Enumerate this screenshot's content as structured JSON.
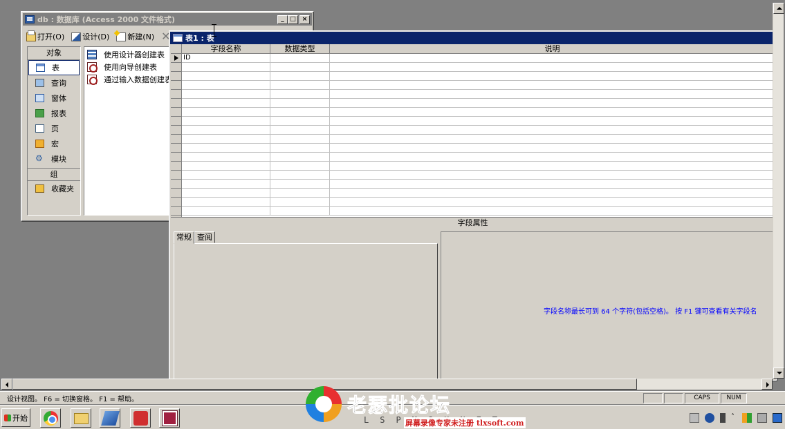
{
  "db_window": {
    "title": "db : 数据库 (Access 2000 文件格式)",
    "toolbar": {
      "open": "打开(O)",
      "design": "设计(D)",
      "new": "新建(N)",
      "delete": "✕"
    },
    "objects_header": "对象",
    "objects": [
      "表",
      "查询",
      "窗体",
      "报表",
      "页",
      "宏",
      "模块"
    ],
    "group_header": "组",
    "favorites": "收藏夹",
    "list": [
      "使用设计器创建表",
      "使用向导创建表",
      "通过输入数据创建表"
    ]
  },
  "table_window": {
    "title": "表1 : 表",
    "columns": {
      "field_name": "字段名称",
      "data_type": "数据类型",
      "description": "说明"
    },
    "rows": [
      {
        "field_name": "ID",
        "data_type": "",
        "description": ""
      }
    ],
    "field_properties_header": "字段属性",
    "tabs": [
      "常规",
      "查阅"
    ],
    "hint": "字段名称最长可到 64 个字符(包括空格)。 按 F1 键可查看有关字段名"
  },
  "status_bar": {
    "text": "设计视图。  F6 = 切换窗格。  F1 = 帮助。",
    "caps": "CAPS",
    "num": "NUM"
  },
  "taskbar": {
    "start": "开始"
  },
  "watermark": {
    "title": "老瑟批论坛",
    "sub": "LSPMSUNET",
    "red": "屏幕录像专家未注册 tlxsoft.com"
  }
}
